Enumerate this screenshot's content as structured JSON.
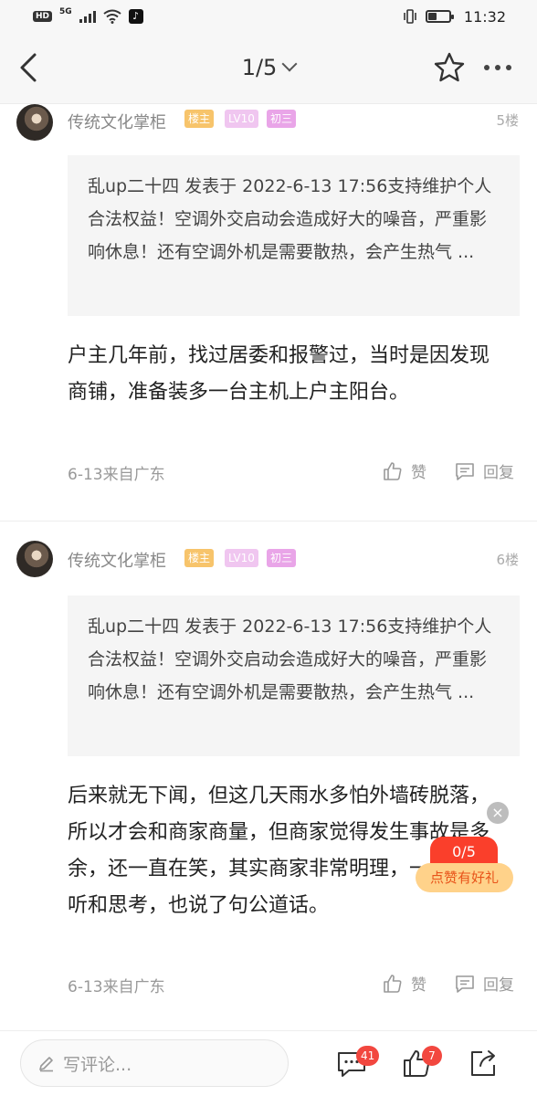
{
  "status_bar": {
    "time": "11:32",
    "network": "5G",
    "hd": "HD"
  },
  "header": {
    "page_indicator": "1/5"
  },
  "posts": [
    {
      "author": "传统文化掌柜",
      "badges": [
        "楼主",
        "LV10",
        "初三"
      ],
      "floor": "5楼",
      "quote": "乱up二十四 发表于 2022-6-13 17:56支持维护个人合法权益！空调外交启动会造成好大的噪音，严重影响休息！还有空调外机是需要散热，会产生热气 ...",
      "content": "户主几年前，找过居委和报警过，当时是因发现商铺，准备装多一台主机上户主阳台。",
      "meta": "6-13来自广东",
      "like_label": "赞",
      "reply_label": "回复"
    },
    {
      "author": "传统文化掌柜",
      "badges": [
        "楼主",
        "LV10",
        "初三"
      ],
      "floor": "6楼",
      "quote": "乱up二十四 发表于 2022-6-13 17:56支持维护个人合法权益！空调外交启动会造成好大的噪音，严重影响休息！还有空调外机是需要散热，会产生热气 ...",
      "content": "后来就无下闻，但这几天雨水多怕外墙砖脱落，所以才会和商家商量，但商家觉得发生事故是多余，还一直在笑，其实商家非常明理，一直认真听和思考，也说了句公道话。",
      "meta": "6-13来自广东",
      "like_label": "赞",
      "reply_label": "回复"
    }
  ],
  "gift": {
    "count": "0/5",
    "label": "点赞有好礼",
    "close": "×"
  },
  "bottom_bar": {
    "comment_placeholder": "写评论...",
    "comment_count": "41",
    "like_count": "7"
  },
  "colors": {
    "badge_owner": "#f7c46b",
    "badge_grade": "#e9a5e8",
    "accent_red": "#fa3f2b"
  }
}
